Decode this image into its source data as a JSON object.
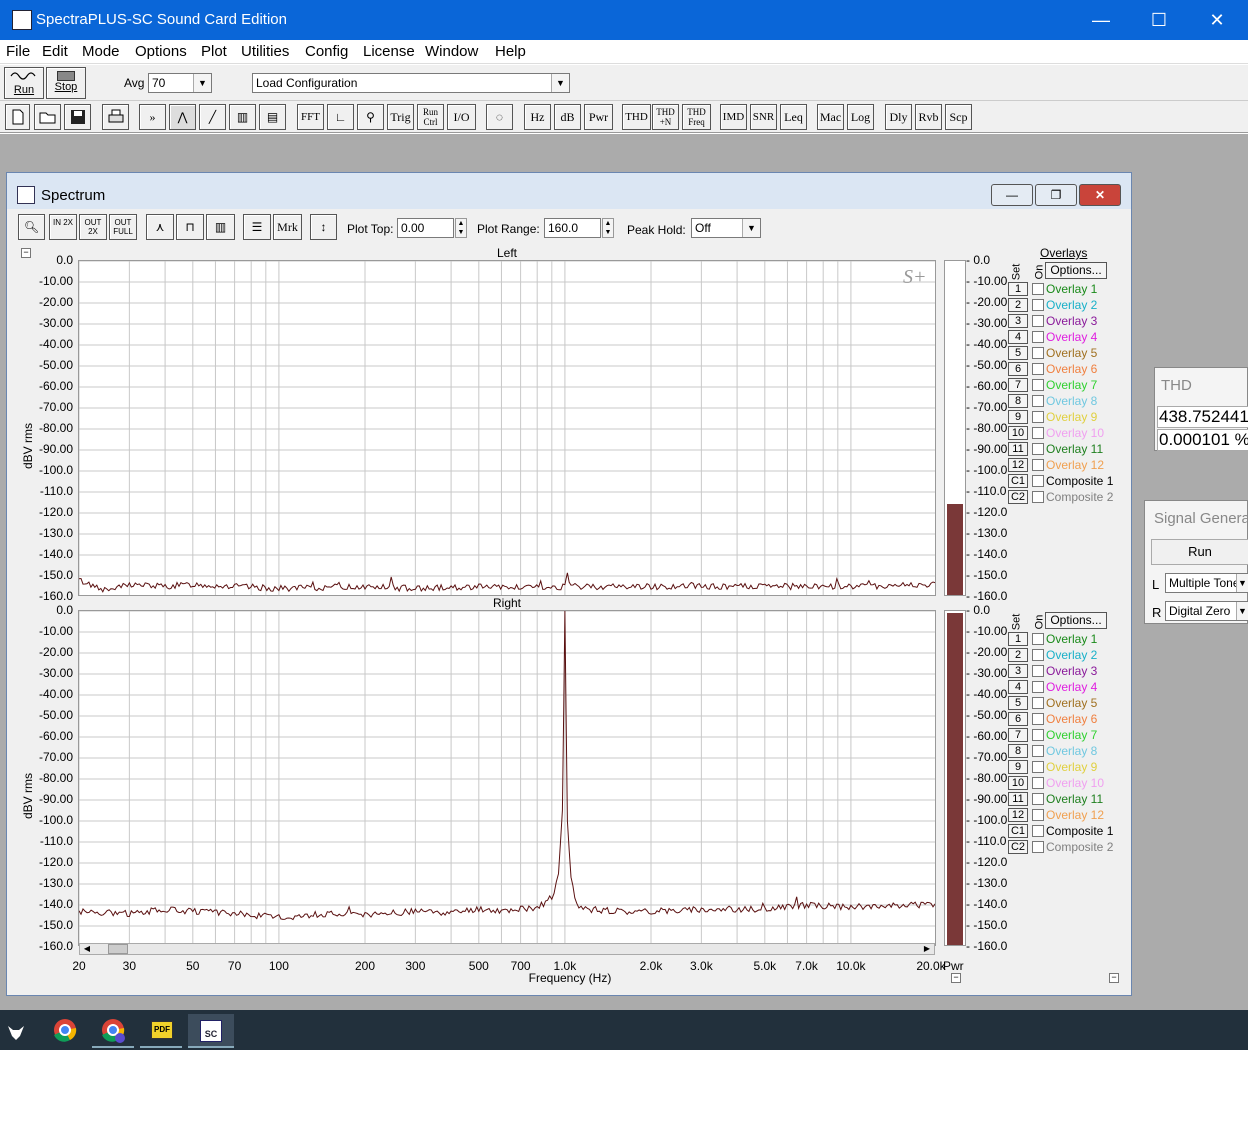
{
  "app": {
    "title": "SpectraPLUS-SC Sound Card Edition",
    "window_controls": {
      "minimize": "—",
      "maximize": "☐",
      "close": "✕"
    }
  },
  "menu": [
    "File",
    "Edit",
    "Mode",
    "Options",
    "Plot",
    "Utilities",
    "Config",
    "License",
    "Window",
    "Help"
  ],
  "toolbar1": {
    "run_label": "Run",
    "stop_label": "Stop",
    "avg_label": "Avg",
    "avg_value": "70",
    "config_value": "Load Configuration"
  },
  "toolbar2": {
    "buttons": [
      "FFT",
      "Trig",
      "Run Ctrl",
      "I/O",
      "Hz",
      "dB",
      "Pwr",
      "THD",
      "THD +N",
      "THD Freq",
      "IMD",
      "SNR",
      "Leq",
      "Mac",
      "Log",
      "Dly",
      "Rvb",
      "Scp"
    ]
  },
  "spectrum_window": {
    "title": "Spectrum",
    "mdi_controls": {
      "minimize": "—",
      "restore": "❐",
      "close": "✕"
    },
    "toolbar": {
      "zoom_in_label": "IN 2X",
      "zoom_out_label": "OUT 2X",
      "zoom_full_label": "OUT FULL",
      "marker_label": "Mrk",
      "plot_top_label": "Plot Top:",
      "plot_top_value": "0.00",
      "plot_range_label": "Plot Range:",
      "plot_range_value": "160.0",
      "peak_hold_label": "Peak Hold:",
      "peak_hold_value": "Off"
    },
    "watermark": "S+",
    "y_axis_title": "dBV rms",
    "x_axis_title": "Frequency (Hz)",
    "meter_label": "Pwr",
    "panels": [
      {
        "name": "Left",
        "meter_level_db": -116
      },
      {
        "name": "Right",
        "meter_level_db": 0
      }
    ],
    "overlays_title": "Overlays",
    "set_header": "Set",
    "on_header": "On",
    "options_label": "Options...",
    "overlays": [
      {
        "num": "1",
        "label": "Overlay 1",
        "color": "#1a8a1a"
      },
      {
        "num": "2",
        "label": "Overlay 2",
        "color": "#18b0c8"
      },
      {
        "num": "3",
        "label": "Overlay 3",
        "color": "#8a1a9a"
      },
      {
        "num": "4",
        "label": "Overlay 4",
        "color": "#e020e0"
      },
      {
        "num": "5",
        "label": "Overlay 5",
        "color": "#a07020"
      },
      {
        "num": "6",
        "label": "Overlay 6",
        "color": "#f08040"
      },
      {
        "num": "7",
        "label": "Overlay 7",
        "color": "#30d030"
      },
      {
        "num": "8",
        "label": "Overlay 8",
        "color": "#70c8e0"
      },
      {
        "num": "9",
        "label": "Overlay 9",
        "color": "#e0d040"
      },
      {
        "num": "10",
        "label": "Overlay 10",
        "color": "#f0a0f0"
      },
      {
        "num": "11",
        "label": "Overlay 11",
        "color": "#208020"
      },
      {
        "num": "12",
        "label": "Overlay 12",
        "color": "#f0a050"
      },
      {
        "num": "C1",
        "label": "Composite 1",
        "color": "#000000"
      },
      {
        "num": "C2",
        "label": "Composite 2",
        "color": "#808080"
      }
    ]
  },
  "thd_window": {
    "title": "THD",
    "value1": "438.752441",
    "value2": "0.000101 %"
  },
  "siggen_window": {
    "title": "Signal Generator",
    "run_label": "Run",
    "l_label": "L",
    "l_value": "Multiple Tones",
    "r_label": "R",
    "r_value": "Digital Zero"
  },
  "taskbar": {
    "icons": [
      "fox-app-icon",
      "chrome-icon",
      "chrome-profile-icon",
      "pdf-reader-icon",
      "spectraplus-icon"
    ],
    "pdf_label": "PDF",
    "spectra_label": "SC"
  },
  "chart_data": [
    {
      "type": "line",
      "title": "Left",
      "xlabel": "Frequency (Hz)",
      "ylabel": "dBV rms",
      "x_scale": "log",
      "xlim": [
        20,
        20000
      ],
      "ylim": [
        -160,
        0
      ],
      "x_ticks": [
        "20",
        "30",
        "50",
        "70",
        "100",
        "200",
        "300",
        "500",
        "700",
        "1.0k",
        "2.0k",
        "3.0k",
        "5.0k",
        "7.0k",
        "10.0k",
        "20.0k"
      ],
      "y_ticks": [
        "0.0",
        "-10.00",
        "-20.00",
        "-30.00",
        "-40.00",
        "-50.00",
        "-60.00",
        "-70.00",
        "-80.00",
        "-90.00",
        "-100.0",
        "-110.0",
        "-120.0",
        "-130.0",
        "-140.0",
        "-150.0",
        "-160.0"
      ],
      "grid": true,
      "series": [
        {
          "x": [
            20,
            25,
            30,
            40,
            50,
            70,
            100,
            200,
            300,
            500,
            700,
            1000,
            1020,
            1050,
            2000,
            3000,
            5000,
            7000,
            10000,
            20000
          ],
          "y": [
            -152,
            -157,
            -154,
            -155,
            -154,
            -155,
            -156,
            -155,
            -156,
            -155,
            -156,
            -155,
            -150,
            -155,
            -155,
            -155,
            -155,
            -155,
            -155,
            -154
          ]
        }
      ],
      "color": "#5a1010"
    },
    {
      "type": "line",
      "title": "Right",
      "xlabel": "Frequency (Hz)",
      "ylabel": "dBV rms",
      "x_scale": "log",
      "xlim": [
        20,
        20000
      ],
      "ylim": [
        -160,
        0
      ],
      "grid": true,
      "series": [
        {
          "x": [
            20,
            30,
            40,
            50,
            70,
            100,
            150,
            200,
            300,
            400,
            500,
            600,
            700,
            800,
            900,
            950,
            980,
            1000,
            1020,
            1050,
            1100,
            1200,
            1500,
            2000,
            3000,
            5000,
            7000,
            10000,
            15000,
            20000
          ],
          "y": [
            -143,
            -144,
            -142,
            -143,
            -144,
            -146,
            -144,
            -145,
            -143,
            -144,
            -142,
            -143,
            -142,
            -141,
            -138,
            -125,
            -95,
            0,
            -100,
            -128,
            -140,
            -142,
            -143,
            -143,
            -142,
            -142,
            -140,
            -141,
            -140,
            -140
          ]
        }
      ],
      "color": "#5a1010"
    }
  ]
}
